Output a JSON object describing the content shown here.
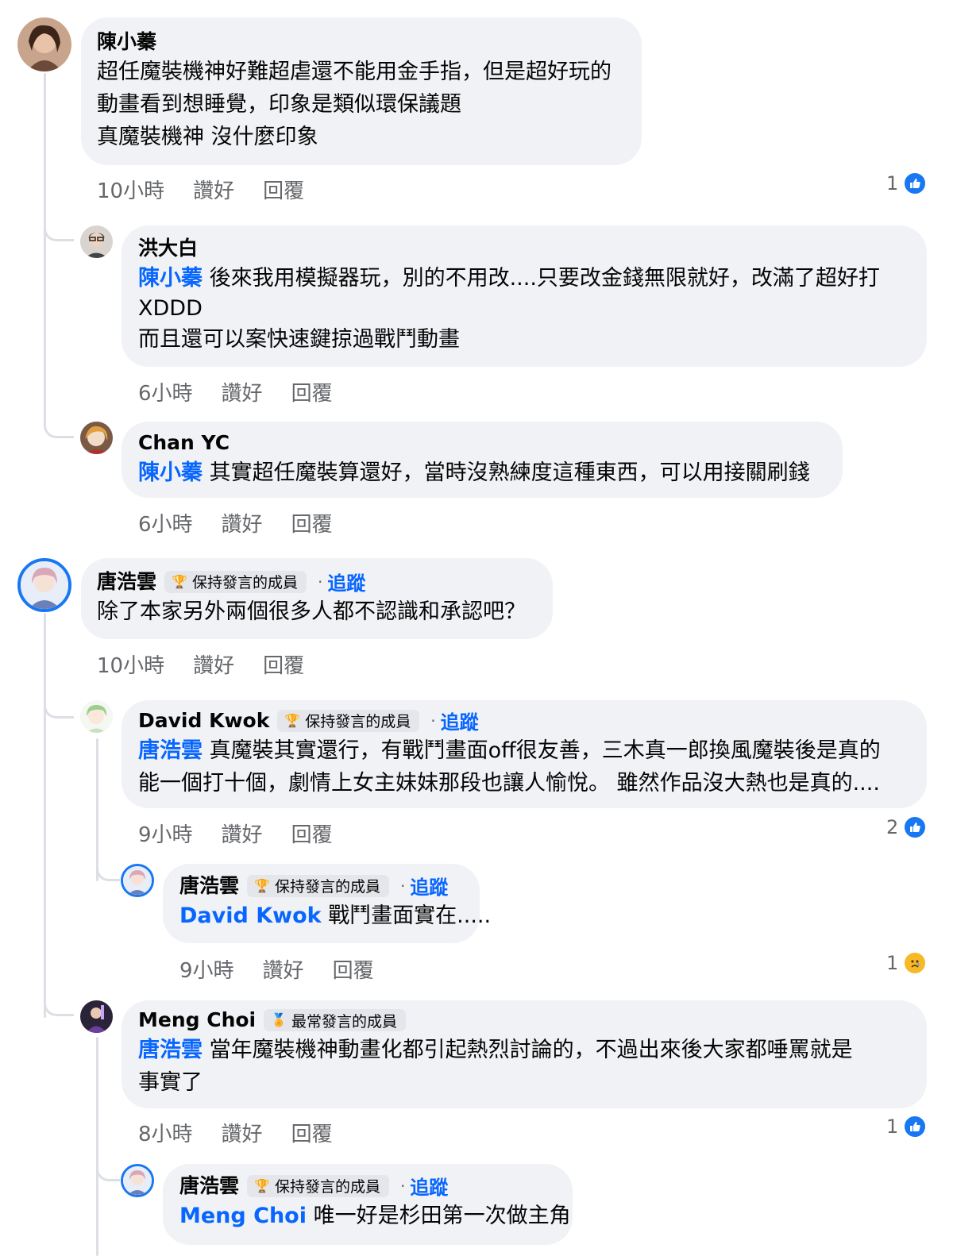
{
  "comments": [
    {
      "author": "陳小蓁",
      "lines": [
        "超任魔裝機神好難超虐還不能用金手指，但是超好玩的",
        "動畫看到想睡覺，印象是類似環保議題",
        "真魔裝機神 沒什麼印象"
      ],
      "time": "10小時",
      "like": "讚好",
      "reply": "回覆",
      "reaction_count": "1",
      "reaction_icon": "like-icon"
    },
    {
      "author": "洪大白",
      "mention": "陳小蓁",
      "line1": "後來我用模擬器玩，別的不用改....只要改金錢無限就好，改滿了超好打",
      "line2": "XDDD",
      "line3": "而且還可以案快速鍵掠過戰鬥動畫",
      "time": "6小時",
      "like": "讚好",
      "reply": "回覆"
    },
    {
      "author": "Chan YC",
      "mention": "陳小蓁",
      "line1": "其實超任魔裝算還好，當時沒熟練度這種東西，可以用接關刷錢",
      "time": "6小時",
      "like": "讚好",
      "reply": "回覆"
    },
    {
      "author": "唐浩雲",
      "badge": "保持發言的成員",
      "follow": "追蹤",
      "line1": "除了本家另外兩個很多人都不認識和承認吧？",
      "time": "10小時",
      "like": "讚好",
      "reply": "回覆"
    },
    {
      "author": "David Kwok",
      "badge": "保持發言的成員",
      "follow": "追蹤",
      "mention": "唐浩雲",
      "line1": "真魔裝其實還行，有戰鬥畫面off很友善，三木真一郎換風魔裝後是真的",
      "line2": "能一個打十個，劇情上女主妹妹那段也讓人愉悅。 雖然作品沒大熱也是真的....",
      "time": "9小時",
      "like": "讚好",
      "reply": "回覆",
      "reaction_count": "2",
      "reaction_icon": "like-icon"
    },
    {
      "author": "唐浩雲",
      "badge": "保持發言的成員",
      "follow": "追蹤",
      "mention": "David Kwok",
      "line1": "戰鬥畫面實在.....",
      "time": "9小時",
      "like": "讚好",
      "reply": "回覆",
      "reaction_count": "1",
      "reaction_icon": "sad-face-icon"
    },
    {
      "author": "Meng Choi",
      "badge": "最常發言的成員",
      "mention": "唐浩雲",
      "line1": "當年魔裝機神動畫化都引起熱烈討論的，不過出來後大家都唾罵￼就是",
      "line2": "事實了￼",
      "time": "8小時",
      "like": "讚好",
      "reply": "回覆",
      "reaction_count": "1",
      "reaction_icon": "like-icon"
    },
    {
      "author": "唐浩雲",
      "badge": "保持發言的成員",
      "follow": "追蹤",
      "mention": "Meng Choi",
      "line1": "唯一好是杉田第一次做主角"
    }
  ],
  "dot": "·",
  "colors": {
    "link": "#0866ff",
    "bubble": "#f0f2f5",
    "meta": "#65676b",
    "like": "#1877f2",
    "sad": "#f7b928"
  }
}
